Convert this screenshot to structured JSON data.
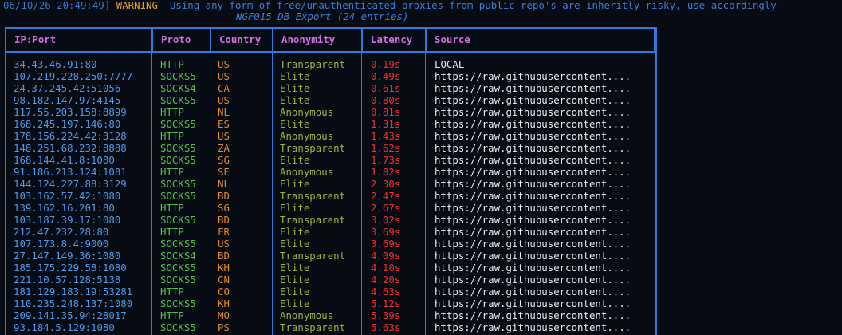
{
  "log": {
    "timestamp": "06/10/26 20:49:49]",
    "level": "WARNING",
    "message": "Using any form of free/unauthenticated proxies from public repo's are inheritly risky, use accordingly"
  },
  "export_title": "NGF015 DB Export (24 entries)",
  "colors": {
    "border": "#2f7bd9",
    "header_text": "#d26fe0",
    "ip": "#4f9be8",
    "proto": "#54c24d",
    "country": "#e08a32",
    "anonymity": "#9fb43c",
    "latency": "#f03030",
    "source": "#e8ecef",
    "warning": "#e6a23c"
  },
  "table": {
    "columns": [
      "IP:Port",
      "Proto",
      "Country",
      "Anonymity",
      "Latency",
      "Source"
    ],
    "rows": [
      [
        "34.43.46.91:80",
        "HTTP",
        "US",
        "Transparent",
        "0.19s",
        "LOCAL"
      ],
      [
        "107.219.228.250:7777",
        "SOCKS5",
        "US",
        "Elite",
        "0.49s",
        "https://raw.githubusercontent...."
      ],
      [
        "24.37.245.42:51056",
        "SOCKS4",
        "CA",
        "Elite",
        "0.61s",
        "https://raw.githubusercontent...."
      ],
      [
        "98.182.147.97:4145",
        "SOCKS5",
        "US",
        "Elite",
        "0.80s",
        "https://raw.githubusercontent...."
      ],
      [
        "117.55.203.158:8899",
        "HTTP",
        "NL",
        "Anonymous",
        "0.81s",
        "https://raw.githubusercontent...."
      ],
      [
        "168.245.197.146:80",
        "SOCKS5",
        "ES",
        "Elite",
        "1.31s",
        "https://raw.githubusercontent...."
      ],
      [
        "178.156.224.42:3128",
        "HTTP",
        "US",
        "Anonymous",
        "1.43s",
        "https://raw.githubusercontent...."
      ],
      [
        "148.251.68.232:8888",
        "SOCKS5",
        "ZA",
        "Transparent",
        "1.62s",
        "https://raw.githubusercontent...."
      ],
      [
        "168.144.41.8:1080",
        "SOCKS5",
        "SG",
        "Elite",
        "1.73s",
        "https://raw.githubusercontent...."
      ],
      [
        "91.186.213.124:1081",
        "HTTP",
        "SE",
        "Anonymous",
        "1.82s",
        "https://raw.githubusercontent...."
      ],
      [
        "144.124.227.88:3129",
        "SOCKS5",
        "NL",
        "Elite",
        "2.30s",
        "https://raw.githubusercontent...."
      ],
      [
        "103.162.57.42:1080",
        "SOCKS5",
        "BD",
        "Transparent",
        "2.47s",
        "https://raw.githubusercontent...."
      ],
      [
        "139.162.16.201:80",
        "HTTP",
        "SG",
        "Elite",
        "2.67s",
        "https://raw.githubusercontent...."
      ],
      [
        "103.187.39.17:1080",
        "SOCKS5",
        "BD",
        "Transparent",
        "3.02s",
        "https://raw.githubusercontent...."
      ],
      [
        "212.47.232.28:80",
        "HTTP",
        "FR",
        "Elite",
        "3.69s",
        "https://raw.githubusercontent...."
      ],
      [
        "107.173.8.4:9000",
        "SOCKS5",
        "US",
        "Elite",
        "3.69s",
        "https://raw.githubusercontent...."
      ],
      [
        "27.147.149.36:1080",
        "SOCKS4",
        "BD",
        "Transparent",
        "4.09s",
        "https://raw.githubusercontent...."
      ],
      [
        "185.175.229.58:1080",
        "SOCKS5",
        "KH",
        "Elite",
        "4.10s",
        "https://raw.githubusercontent...."
      ],
      [
        "221.10.57.128:5138",
        "SOCKS5",
        "CN",
        "Elite",
        "4.20s",
        "https://raw.githubusercontent...."
      ],
      [
        "181.129.183.19:53281",
        "HTTP",
        "CO",
        "Elite",
        "4.63s",
        "https://raw.githubusercontent...."
      ],
      [
        "110.235.248.137:1080",
        "SOCKS5",
        "KH",
        "Elite",
        "5.12s",
        "https://raw.githubusercontent...."
      ],
      [
        "209.141.35.94:28017",
        "HTTP",
        "MO",
        "Anonymous",
        "5.39s",
        "https://raw.githubusercontent...."
      ],
      [
        "93.184.5.129:1080",
        "SOCKS5",
        "PS",
        "Transparent",
        "5.63s",
        "https://raw.githubusercontent...."
      ]
    ]
  }
}
